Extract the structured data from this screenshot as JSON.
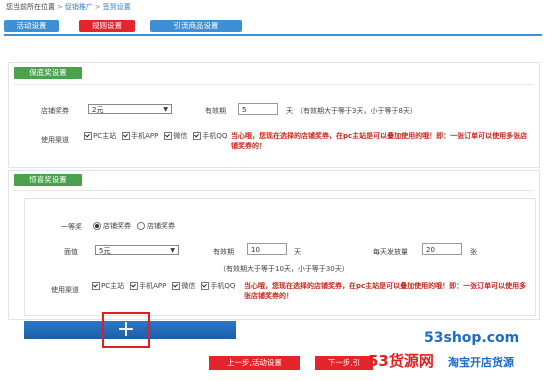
{
  "breadcrumb": {
    "prefix": "您当前所在位置",
    "item1": "促销推广",
    "item2": "签到设置"
  },
  "tabs": [
    {
      "label": "活动设置",
      "color": "#3d8fd6"
    },
    {
      "label": "规则设置",
      "color": "#e5242b"
    },
    {
      "label": "引流商品设置",
      "color": "#3d8fd6"
    }
  ],
  "guarantee": {
    "title": "保底奖设置",
    "coupon_label": "店铺奖券",
    "coupon_value": "2元",
    "validity_label": "有效期",
    "validity_value": "5",
    "validity_unit": "天",
    "validity_note": "（有效期大于等于3天，小于等于8天）",
    "channel_label": "使用渠道",
    "channels": [
      "PC主站",
      "手机APP",
      "微信",
      "手机QQ"
    ],
    "warning": "当心哦，您现在选择的店铺奖券，在pc主站是可以叠加使用的哦！即：一张订单可以使用多张店铺奖券的！"
  },
  "surprise": {
    "title": "惊喜奖设置",
    "prize_label": "一等奖",
    "radio_options": [
      "店铺奖券",
      "店铺奖券"
    ],
    "face_label": "面值",
    "face_value": "5元",
    "validity_label": "有效期",
    "validity_value": "10",
    "validity_unit": "天",
    "daily_label": "每天发放量",
    "daily_value": "20",
    "daily_unit": "张",
    "validity_note": "（有效期大于等于10天，小于等于30天）",
    "channel_label": "使用渠道",
    "channels": [
      "PC主站",
      "手机APP",
      "微信",
      "手机QQ"
    ],
    "warning": "当心哦，您现在选择的店铺奖券，在pc主站是可以叠加使用的哦！即：一张订单可以使用多张店铺奖券的！"
  },
  "add_symbol": "+",
  "footer": {
    "prev_label": "上一步,活动设置",
    "next_label": "下一步,引"
  },
  "watermark": {
    "site": "53shop.com",
    "brand": "53货源网",
    "slogan": "淘宝开店货源"
  },
  "colors": {
    "tab_blue": "#3d8fd6",
    "red": "#e5242b",
    "green": "#4aa24c",
    "blue_bar": "#1f5ea6"
  }
}
